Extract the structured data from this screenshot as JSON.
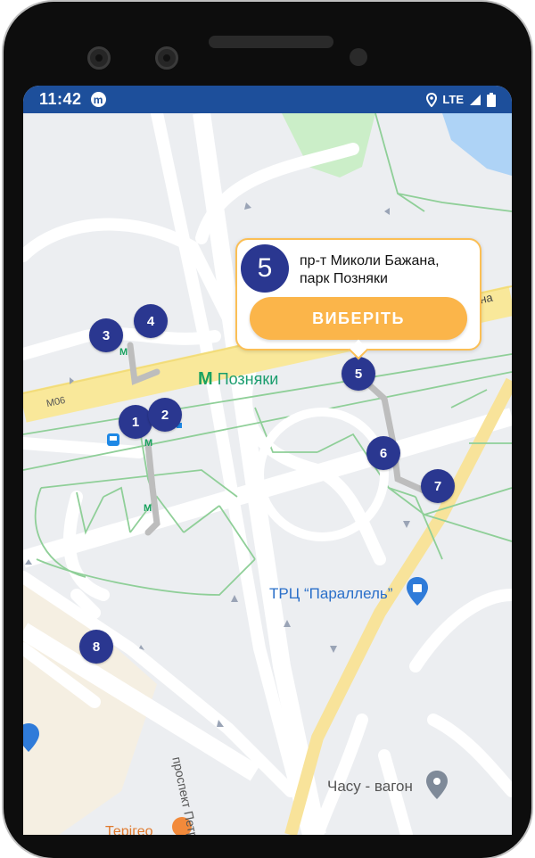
{
  "status_bar": {
    "time": "11:42",
    "app_badge": "m",
    "network": "LTE"
  },
  "map": {
    "metro_station": "Позняки",
    "road_label": "М06",
    "road_label_right": "на",
    "mall_label": "ТРЦ “Параллель”",
    "cafe_label": "Часу - вагон",
    "street_label": "проспект Петра Григ",
    "bottom_label": "Терігео"
  },
  "markers": [
    "1",
    "2",
    "3",
    "4",
    "5",
    "6",
    "7",
    "8"
  ],
  "popup": {
    "number": "5",
    "address_line1": "пр-т Миколи Бажана,",
    "address_line2": "парк Позняки",
    "button_label": "ВИБЕРІТЬ"
  },
  "colors": {
    "status_bar": "#1d4f9b",
    "marker": "#2a3790",
    "accent": "#fbb54a",
    "metro_green": "#1aa260"
  }
}
